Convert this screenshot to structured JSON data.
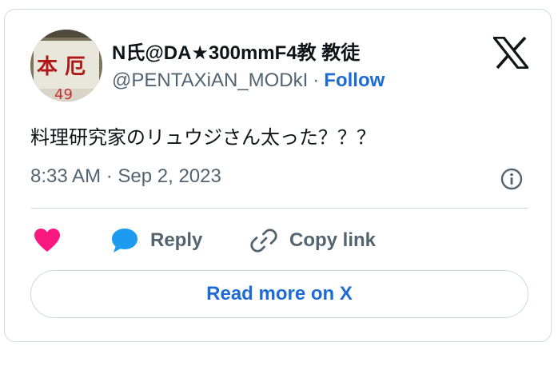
{
  "tweet": {
    "author": {
      "display_name": "N氏@DA★300mmF4教 教徒",
      "handle": "@PENTAXiAN_MODkI",
      "separator": "·",
      "follow_label": "Follow",
      "avatar_text": "本 厄",
      "avatar_number": "49"
    },
    "text": "料理研究家のリュウジさん太った？？？",
    "timestamp": "8:33 AM · Sep 2, 2023",
    "actions": {
      "like_label": "",
      "reply_label": "Reply",
      "copy_link_label": "Copy link"
    },
    "read_more_label": "Read more on X"
  },
  "colors": {
    "accent": "#1d6bd4",
    "like": "#f91880",
    "reply": "#1d9bf0",
    "secondary_text": "#536471",
    "border": "#cfd9de"
  },
  "icons": {
    "brand": "x-logo-icon",
    "info": "info-icon",
    "like": "heart-icon",
    "reply": "speech-bubble-icon",
    "copy": "link-icon"
  }
}
